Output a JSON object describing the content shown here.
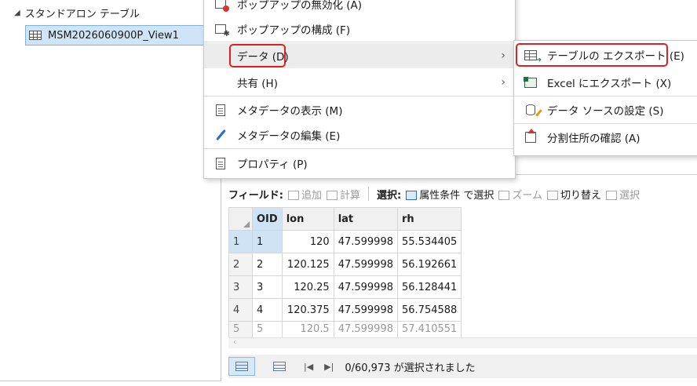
{
  "contents": {
    "group_label": "スタンドアロン テーブル",
    "table_name": "MSM2026060900P_View1"
  },
  "context_menu": {
    "items": [
      {
        "label": "ポップアップの無効化 (A)",
        "icon": "popup-disable-icon"
      },
      {
        "label": "ポップアップの構成 (F)",
        "icon": "popup-config-icon"
      },
      {
        "label": "データ (D)",
        "submenu": true
      },
      {
        "label": "共有 (H)",
        "submenu": true
      },
      {
        "label": "メタデータの表示 (M)",
        "icon": "metadata-view-icon"
      },
      {
        "label": "メタデータの編集 (E)",
        "icon": "pencil-icon"
      },
      {
        "label": "プロパティ (P)",
        "icon": "properties-icon"
      }
    ],
    "submenu_arrow": "›"
  },
  "data_submenu": {
    "items": [
      {
        "label": "テーブルの エクスポート (E)",
        "icon": "table-export-icon"
      },
      {
        "label": "Excel にエクスポート (X)",
        "icon": "excel-export-icon"
      },
      {
        "label": "データ ソースの設定 (S)",
        "icon": "data-source-icon"
      },
      {
        "label": "分割住所の確認 (A)",
        "icon": "address-icon"
      }
    ]
  },
  "toolbar": {
    "field_label": "フィールド:",
    "add": "追加",
    "calculate": "計算",
    "select_label": "選択:",
    "select_by_attr": "属性条件 で選択",
    "zoom": "ズーム",
    "switch": "切り替え",
    "select": "選択"
  },
  "table": {
    "columns": [
      "OID",
      "lon",
      "lat",
      "rh"
    ],
    "rows": [
      {
        "n": "1",
        "oid": "1",
        "lon": "120",
        "lat": "47.599998",
        "rh": "55.534405"
      },
      {
        "n": "2",
        "oid": "2",
        "lon": "120.125",
        "lat": "47.599998",
        "rh": "56.192661"
      },
      {
        "n": "3",
        "oid": "3",
        "lon": "120.25",
        "lat": "47.599998",
        "rh": "56.128441"
      },
      {
        "n": "4",
        "oid": "4",
        "lon": "120.375",
        "lat": "47.599998",
        "rh": "56.754588"
      },
      {
        "n": "5",
        "oid": "5",
        "lon": "120.5",
        "lat": "47.599998",
        "rh": "57.410551"
      }
    ]
  },
  "status": {
    "selection_text": "0/60,973 が選択されました",
    "first_btn": "|◀",
    "last_btn": "▶|"
  },
  "colors": {
    "highlight_border": "#e02020",
    "selection_blue": "#cfe5f7"
  }
}
